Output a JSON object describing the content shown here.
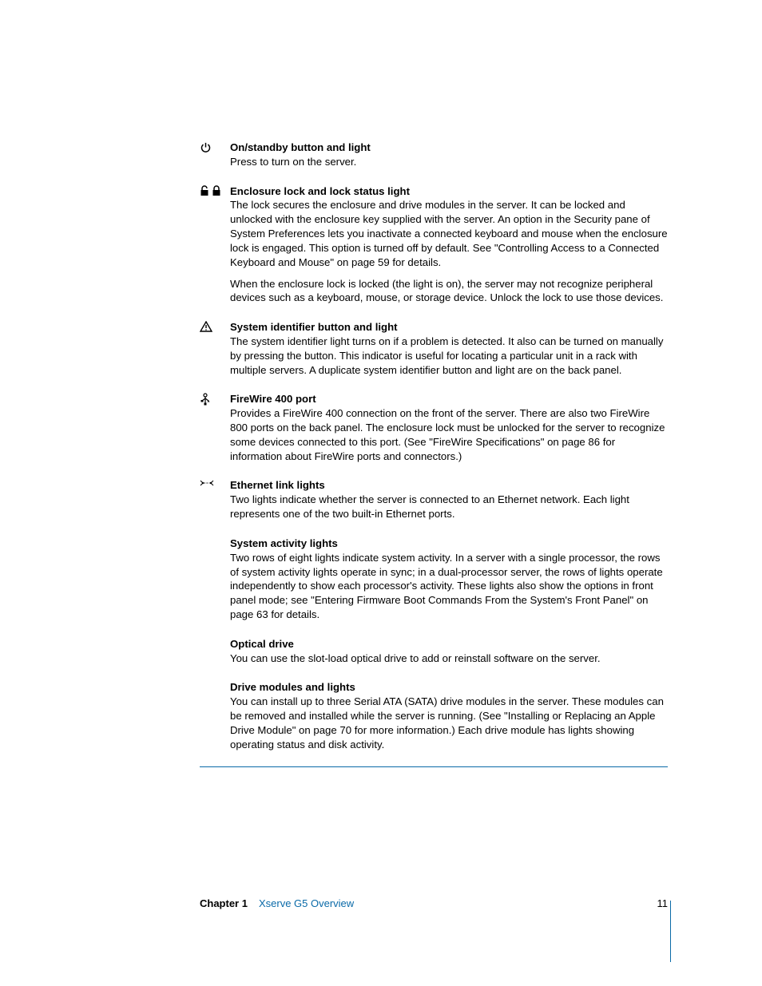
{
  "sections": [
    {
      "icon": "power-icon",
      "heading": "On/standby button and light",
      "paras": [
        "Press to turn on the server."
      ]
    },
    {
      "icon": "lock-icons",
      "heading": "Enclosure lock and lock status light",
      "paras": [
        "The lock secures the enclosure and drive modules in the server. It can be locked and unlocked with the enclosure key supplied with the server. An option in the Security pane of System Preferences lets you inactivate a connected keyboard and mouse when the enclosure lock is engaged. This option is turned off by default. See \"Controlling Access to a Connected Keyboard and Mouse\" on page 59 for details.",
        "When the enclosure lock is locked (the light is on), the server may not recognize peripheral devices such as a keyboard, mouse, or storage device. Unlock the lock to use those devices."
      ]
    },
    {
      "icon": "warning-icon",
      "heading": "System identifier button and light",
      "paras": [
        "The system identifier light turns on if a problem is detected. It also can be turned on manually by pressing the button. This indicator is useful for locating a particular unit in a rack with multiple servers. A duplicate system identifier button and light are on the back panel."
      ]
    },
    {
      "icon": "firewire-icon",
      "heading": "FireWire 400 port",
      "paras": [
        "Provides a FireWire 400 connection on the front of the server. There are also two FireWire 800 ports on the back panel. The enclosure lock must be unlocked for the server to recognize some devices connected to this port. (See \"FireWire Specifications\" on page 86 for information about FireWire ports and connectors.)"
      ]
    },
    {
      "icon": "ethernet-icon",
      "heading": "Ethernet link lights",
      "paras": [
        "Two lights indicate whether the server is connected to an Ethernet network. Each light represents one of the two built-in Ethernet ports."
      ]
    },
    {
      "icon": "",
      "heading": "System activity lights",
      "paras": [
        "Two rows of eight lights indicate system activity. In a server with a single processor, the rows of system activity lights operate in sync; in a dual-processor server, the rows of lights operate independently to show each processor's activity. These lights also show the options in front panel mode; see \"Entering Firmware Boot Commands From the System's Front Panel\" on page 63 for details."
      ]
    },
    {
      "icon": "",
      "heading": "Optical drive",
      "paras": [
        "You can use the slot-load optical drive to add or reinstall software on the server."
      ]
    },
    {
      "icon": "",
      "heading": "Drive modules and lights",
      "paras": [
        "You can install up to three Serial ATA (SATA) drive modules in the server. These modules can be removed and installed while the server is running. (See \"Installing or Replacing an Apple Drive Module\" on page 70 for more information.) Each drive module has lights showing operating status and disk activity."
      ]
    }
  ],
  "footer": {
    "chapter_label": "Chapter 1",
    "chapter_title": "Xserve G5 Overview",
    "page_number": "11"
  }
}
